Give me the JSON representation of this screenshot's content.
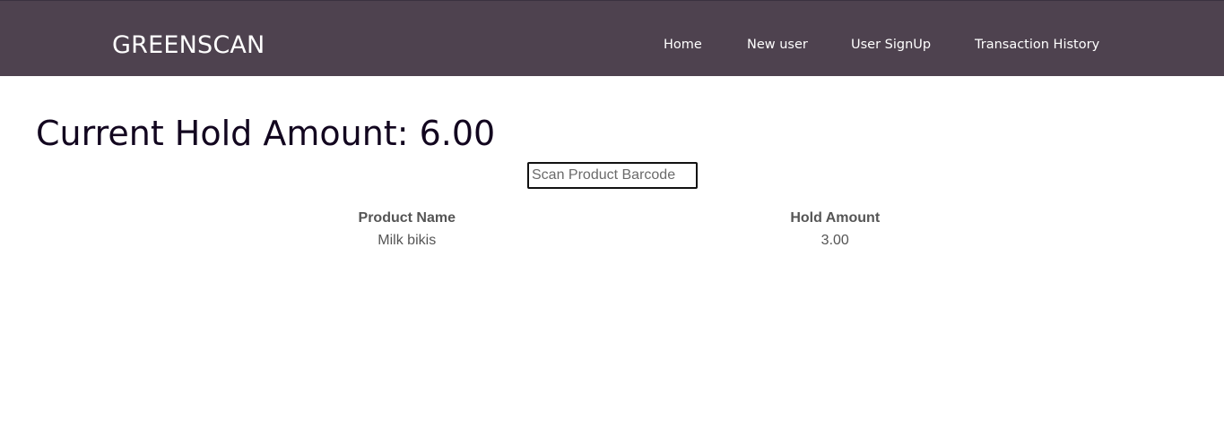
{
  "nav": {
    "brand": "GREENSCAN",
    "links": [
      {
        "label": "Home"
      },
      {
        "label": "New user"
      },
      {
        "label": "User SignUp"
      },
      {
        "label": "Transaction History"
      }
    ]
  },
  "main": {
    "heading": "Current Hold Amount: 6.00",
    "barcode_input": {
      "value": "",
      "placeholder": "Scan Product Barcode"
    },
    "table": {
      "columns": [
        "Product Name",
        "Hold Amount"
      ],
      "rows": [
        [
          "Milk bikis",
          "3.00"
        ]
      ]
    }
  },
  "colors": {
    "navbar": "#4e424f",
    "heading": "#12061f",
    "table_text": "#555555"
  }
}
